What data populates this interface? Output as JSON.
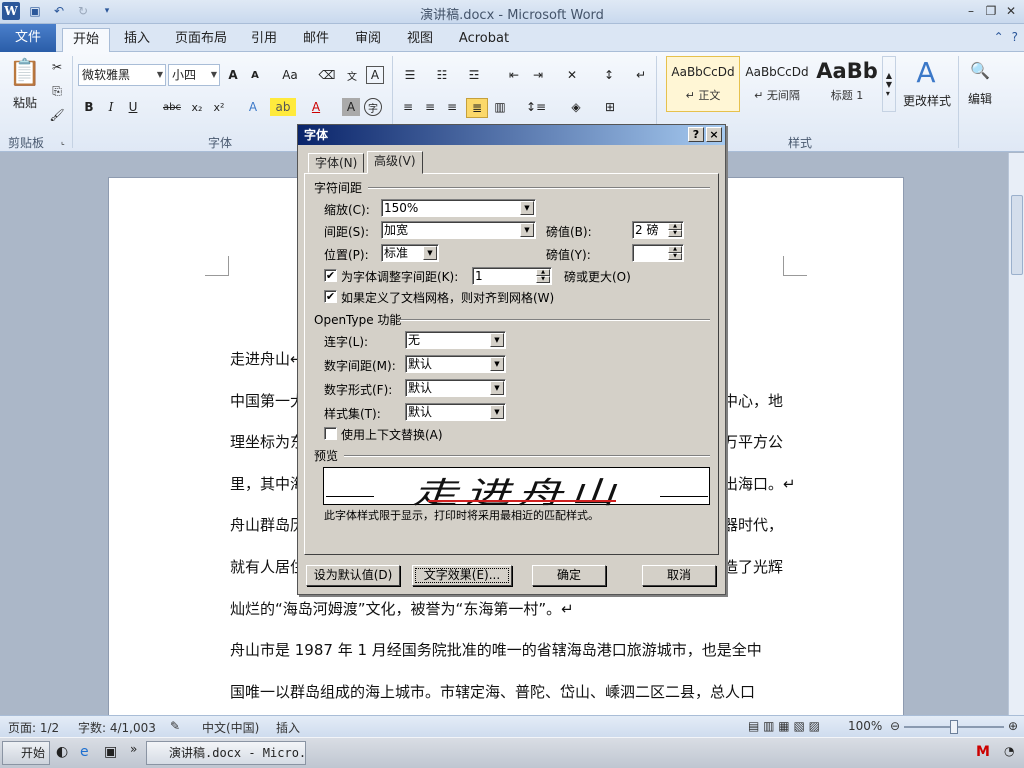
{
  "window": {
    "title": "演讲稿.docx - Microsoft Word",
    "qat_icons": [
      "word-logo",
      "save-icon",
      "undo-icon",
      "redo-icon",
      "customize-icon"
    ]
  },
  "ribbon_tabs": [
    "文件",
    "开始",
    "插入",
    "页面布局",
    "引用",
    "邮件",
    "审阅",
    "视图",
    "Acrobat"
  ],
  "ribbon": {
    "paste_label": "粘贴",
    "clipboard_label": "剪贴板",
    "font_group_label": "字体",
    "styles_group_label": "样式",
    "font_name": "微软雅黑",
    "font_size": "小四",
    "styles": [
      {
        "sample": "AaBbCcDd",
        "name": "↵ 正文"
      },
      {
        "sample": "AaBbCcDd",
        "name": "↵ 无间隔"
      },
      {
        "sample": "AaBb",
        "name": "标题 1"
      }
    ],
    "change_styles_label": "更改样式",
    "edit_label": "编辑"
  },
  "document": {
    "lines": [
      "走进舟山↵",
      "中国第一大",
      "理坐标为东",
      "里，其中海",
      "舟山群岛历",
      "就有人居住",
      "灿烂的“海岛河姆渡”文化，被誉为“东海第一村”。↵",
      "舟山市是 1987 年 1 月经国务院批准的唯一的省辖海岛港口旅游城市，也是全中",
      "国唯一以群岛组成的海上城市。市辖定海、普陀、岱山、嵊泗二区二县，总人口"
    ],
    "right_lines": [
      "中心，地",
      "万平方公",
      "出海口。↵",
      "器时代，",
      "造了光辉"
    ]
  },
  "dialog": {
    "title": "字体",
    "help_btn": "?",
    "close_btn": "×",
    "tabs": [
      "字体(N)",
      "高级(V)"
    ],
    "spacing_section": "字符间距",
    "scale_label": "缩放(C):",
    "scale_value": "150%",
    "spacing_label": "间距(S):",
    "spacing_value": "加宽",
    "spacing_pt_label": "磅值(B):",
    "spacing_pt_value": "2 磅",
    "position_label": "位置(P):",
    "position_value": "标准",
    "position_pt_label": "磅值(Y):",
    "position_pt_value": "",
    "kerning_label": "为字体调整字间距(K):",
    "kerning_value": "1",
    "kerning_suffix": "磅或更大(O)",
    "kerning_checked": "✔",
    "grid_label": "如果定义了文档网格，则对齐到网格(W)",
    "grid_checked": "✔",
    "opentype_section": "OpenType 功能",
    "ligature_label": "连字(L):",
    "ligature_value": "无",
    "numspacing_label": "数字间距(M):",
    "numspacing_value": "默认",
    "numform_label": "数字形式(F):",
    "numform_value": "默认",
    "styleset_label": "样式集(T):",
    "styleset_value": "默认",
    "contextual_label": "使用上下文替换(A)",
    "preview_section": "预览",
    "preview_text": "走进舟山",
    "preview_note": "此字体样式限于显示，打印时将采用最相近的匹配样式。",
    "btn_default": "设为默认值(D)",
    "btn_effects": "文字效果(E)...",
    "btn_ok": "确定",
    "btn_cancel": "取消"
  },
  "status": {
    "page": "页面: 1/2",
    "words": "字数: 4/1,003",
    "lang": "中文(中国)",
    "mode": "插入",
    "zoom": "100%"
  },
  "taskbar": {
    "start": "开始",
    "item": "演讲稿.docx - Micro..."
  }
}
